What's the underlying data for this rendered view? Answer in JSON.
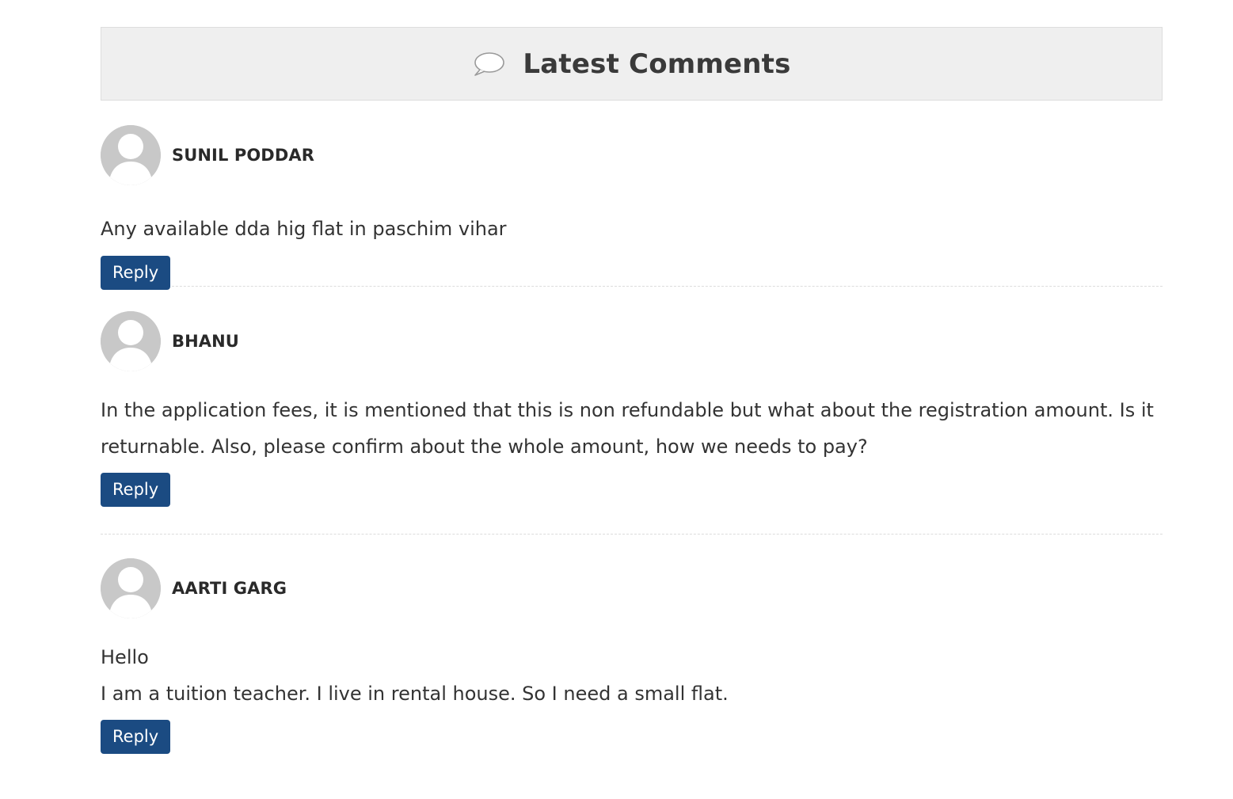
{
  "header": {
    "icon": "speech-bubble-icon",
    "title": "Latest Comments"
  },
  "colors": {
    "header_bg": "#efefef",
    "reply_button": "#1b4b82",
    "avatar": "#c8c8c8"
  },
  "comments": [
    {
      "author": "SUNIL PODDAR",
      "text": "Any available dda hig flat in paschim vihar",
      "reply_label": "Reply"
    },
    {
      "author": "BHANU",
      "text": "In the application fees, it is mentioned that this is non refundable but what about the registration amount. Is it returnable. Also, please confirm about the whole amount, how we needs to pay?",
      "reply_label": "Reply"
    },
    {
      "author": "AARTI GARG",
      "text_line1": "Hello",
      "text_line2": "I am a tuition teacher. I live in rental house. So I need a small flat.",
      "reply_label": "Reply"
    }
  ]
}
